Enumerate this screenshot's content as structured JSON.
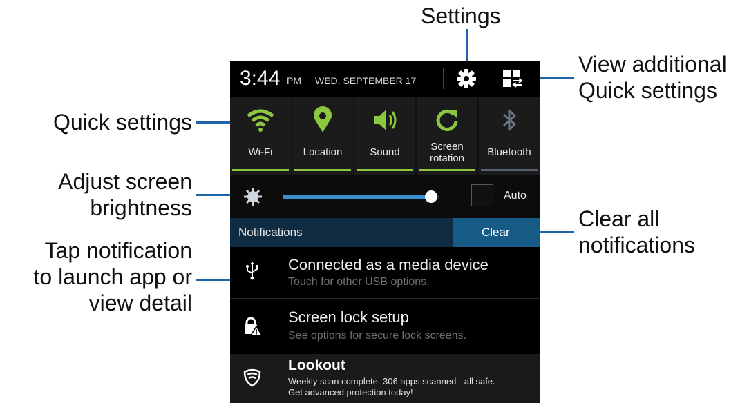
{
  "callouts": {
    "settings": "Settings",
    "view_additional_1": "View additional",
    "view_additional_2": "Quick settings",
    "quick_settings": "Quick settings",
    "adjust_1": "Adjust screen",
    "adjust_2": "brightness",
    "clear_all_1": "Clear all",
    "clear_all_2": "notifications",
    "tap_1": "Tap notification",
    "tap_2": "to launch app or",
    "tap_3": "view detail"
  },
  "status_bar": {
    "time": "3:44",
    "ampm": "PM",
    "date": "WED, SEPTEMBER 17",
    "settings_icon": "gear-icon",
    "quick_settings_icon": "grid-icon"
  },
  "quick_tiles": [
    {
      "label": "Wi-Fi",
      "icon": "wifi-icon",
      "active": true
    },
    {
      "label": "Location",
      "icon": "location-pin-icon",
      "active": true
    },
    {
      "label": "Sound",
      "icon": "speaker-icon",
      "active": true
    },
    {
      "label_line1": "Screen",
      "label_line2": "rotation",
      "icon": "rotate-icon",
      "active": true
    },
    {
      "label": "Bluetooth",
      "icon": "bluetooth-icon",
      "active": false
    }
  ],
  "brightness": {
    "level": 0.95,
    "auto_label": "Auto",
    "auto_checked": false
  },
  "notifications": {
    "header": "Notifications",
    "clear_label": "Clear",
    "items": [
      {
        "icon": "usb-icon",
        "title": "Connected as a media device",
        "subtitle": "Touch for other USB options."
      },
      {
        "icon": "lock-warning-icon",
        "title": "Screen lock setup",
        "subtitle": "See options for secure lock screens."
      },
      {
        "icon": "shield-icon",
        "title": "Lookout",
        "line1": "Weekly scan complete. 306 apps scanned - all safe.",
        "line2": "Get advanced protection today!"
      }
    ]
  },
  "colors": {
    "accent_green": "#8dc63f",
    "accent_blue": "#1f63a8",
    "header_bg": "#0f2c42",
    "clear_bg": "#165a86"
  }
}
